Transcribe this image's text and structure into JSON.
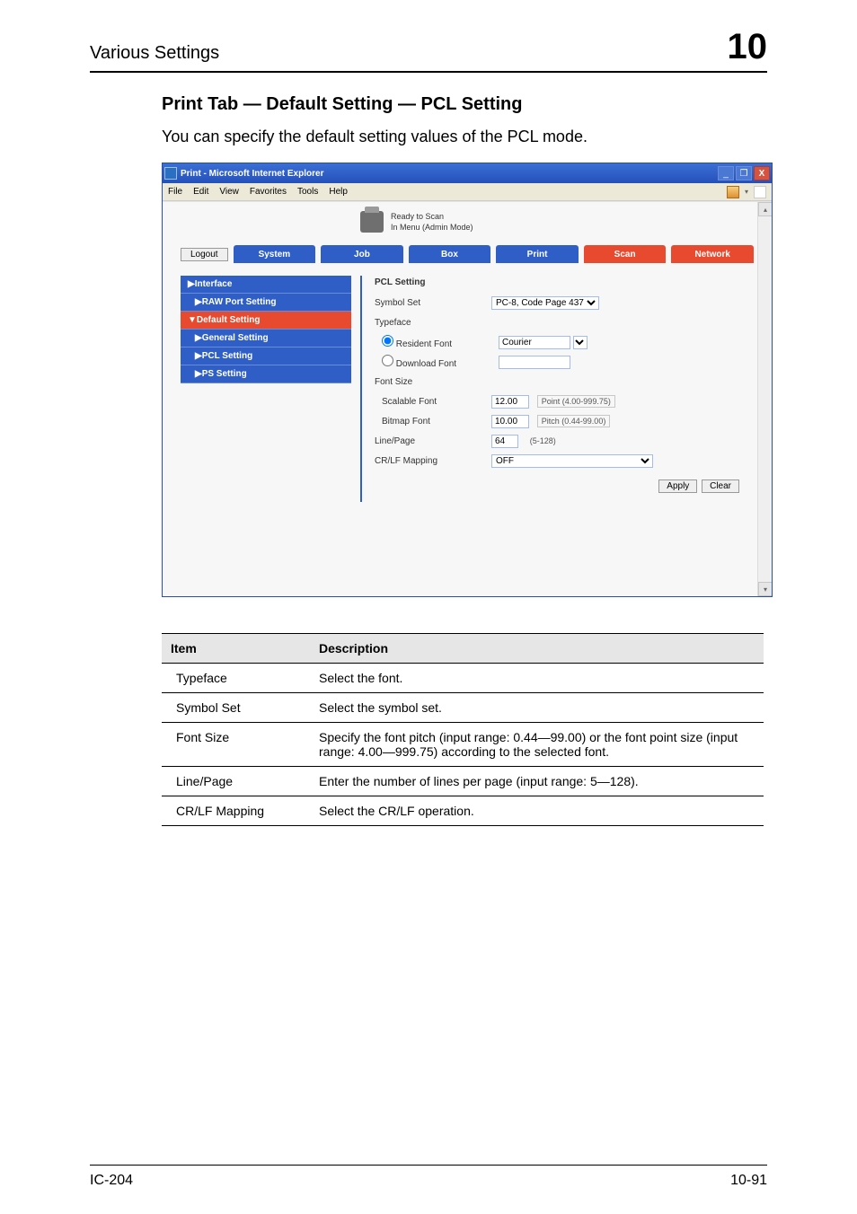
{
  "header": {
    "left": "Various Settings",
    "right": "10"
  },
  "section_title": "Print Tab — Default Setting — PCL Setting",
  "intro": "You can specify the default setting values of the PCL mode.",
  "shot": {
    "title": "Print - Microsoft Internet Explorer",
    "menus": [
      "File",
      "Edit",
      "View",
      "Favorites",
      "Tools",
      "Help"
    ],
    "status1": "Ready to Scan",
    "status2": "In Menu (Admin Mode)",
    "logout": "Logout",
    "tabs": {
      "system": "System",
      "job": "Job",
      "box": "Box",
      "print": "Print",
      "scan": "Scan",
      "network": "Network"
    },
    "sidebar": {
      "interface": "▶Interface",
      "raw": "▶RAW Port Setting",
      "default": "▼Default Setting",
      "general": "▶General Setting",
      "pcl": "▶PCL Setting",
      "ps": "▶PS Setting"
    },
    "form": {
      "heading": "PCL Setting",
      "symbol_label": "Symbol Set",
      "symbol_value": "PC-8, Code Page 437",
      "typeface_label": "Typeface",
      "resident": "Resident Font",
      "download": "Download Font",
      "courier": "Courier",
      "fontsize_label": "Font Size",
      "scalable_label": "Scalable Font",
      "scalable_value": "12.00",
      "scalable_hint": "Point (4.00-999.75)",
      "bitmap_label": "Bitmap Font",
      "bitmap_value": "10.00",
      "bitmap_hint": "Pitch (0.44-99.00)",
      "linepage_label": "Line/Page",
      "linepage_value": "64",
      "linepage_hint": "(5-128)",
      "crlf_label": "CR/LF Mapping",
      "crlf_value": "OFF",
      "apply": "Apply",
      "clear": "Clear"
    }
  },
  "table": {
    "h_item": "Item",
    "h_desc": "Description",
    "rows": [
      {
        "k": "Typeface",
        "v": "Select the font."
      },
      {
        "k": "Symbol Set",
        "v": "Select the symbol set."
      },
      {
        "k": "Font Size",
        "v": "Specify the font pitch (input range: 0.44—99.00) or the font point size (input range: 4.00—999.75) according to the selected font."
      },
      {
        "k": "Line/Page",
        "v": "Enter the number of lines per page (input range: 5—128)."
      },
      {
        "k": "CR/LF Mapping",
        "v": "Select the CR/LF operation."
      }
    ]
  },
  "footer": {
    "left": "IC-204",
    "right": "10-91"
  }
}
